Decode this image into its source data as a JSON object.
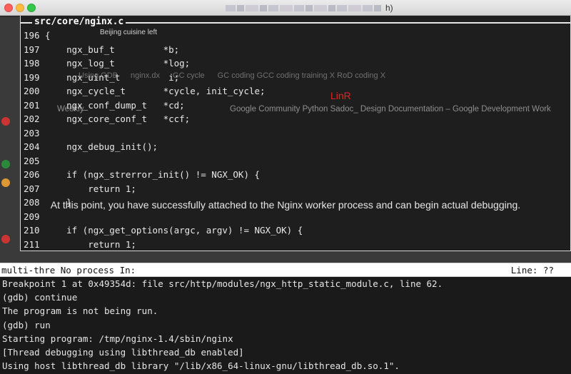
{
  "window": {
    "title_suffix": "h)"
  },
  "source": {
    "title": "src/core/nginx.c",
    "tooltip": "Beijing cuisine left",
    "lines": [
      {
        "num": "196",
        "code": "{"
      },
      {
        "num": "197",
        "code": "    ngx_buf_t         *b;"
      },
      {
        "num": "198",
        "code": "    ngx_log_t         *log;"
      },
      {
        "num": "199",
        "code": "    ngx_uint_t         i;"
      },
      {
        "num": "200",
        "code": "    ngx_cycle_t       *cycle, init_cycle;"
      },
      {
        "num": "201",
        "code": "    ngx_conf_dump_t   *cd;"
      },
      {
        "num": "202",
        "code": "    ngx_core_conf_t   *ccf;"
      },
      {
        "num": "203",
        "code": ""
      },
      {
        "num": "204",
        "code": "    ngx_debug_init();"
      },
      {
        "num": "205",
        "code": ""
      },
      {
        "num": "206",
        "code": "    if (ngx_strerror_init() != NGX_OK) {"
      },
      {
        "num": "207",
        "code": "        return 1;"
      },
      {
        "num": "208",
        "code": "    }"
      },
      {
        "num": "209",
        "code": ""
      },
      {
        "num": "210",
        "code": "    if (ngx_get_options(argc, argv) != NGX_OK) {"
      },
      {
        "num": "211",
        "code": "        return 1;"
      }
    ]
  },
  "overlay": {
    "watermark": "LinR",
    "caption": "At this point, you have successfully attached to the Nginx worker process and can begin actual debugging.",
    "ghost_tabs": [
      "Using GDB",
      "nginx.dx",
      "GC cycle",
      "GC coding GCC coding training X RoD coding X"
    ],
    "ghost_bookmarks": [
      "Weekly",
      "Google Community Python Sadoc_ Design Documentation – Google Development Work"
    ]
  },
  "status": {
    "left": "multi-thre No process In:",
    "right": "Line: ??"
  },
  "console": {
    "lines": [
      "Breakpoint 1 at 0x49354d: file src/http/modules/ngx_http_static_module.c, line 62.",
      "(gdb) continue",
      "The program is not being run.",
      "(gdb) run",
      "Starting program: /tmp/nginx-1.4/sbin/nginx",
      "[Thread debugging using libthread_db enabled]",
      "Using host libthread_db library \"/lib/x86_64-linux-gnu/libthread_db.so.1\"."
    ]
  }
}
